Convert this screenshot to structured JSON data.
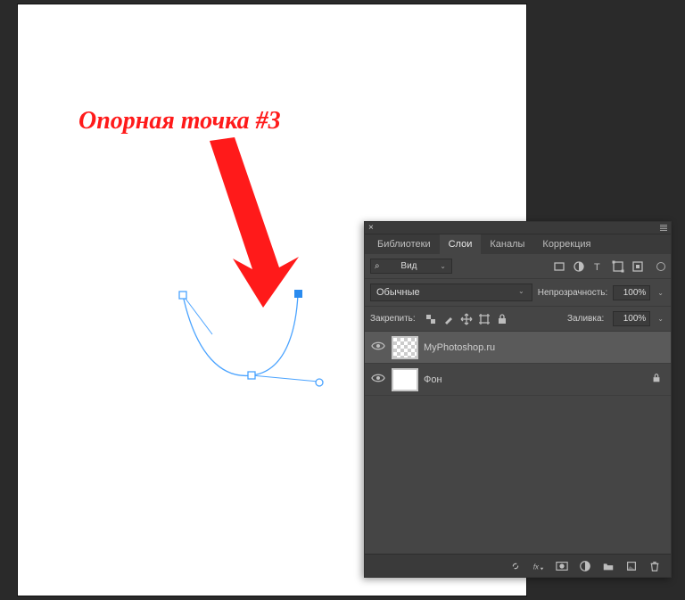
{
  "canvas": {
    "annotation_text": "Опорная точка #3"
  },
  "panel": {
    "tabs": [
      {
        "label": "Библиотеки",
        "active": false
      },
      {
        "label": "Слои",
        "active": true
      },
      {
        "label": "Каналы",
        "active": false
      },
      {
        "label": "Коррекция",
        "active": false
      }
    ],
    "filter": {
      "kind_label": "Вид",
      "search_glyph": "⌕"
    },
    "blend": {
      "mode_label": "Обычные",
      "opacity_label": "Непрозрачность:",
      "opacity_value": "100%"
    },
    "lock": {
      "lock_label": "Закрепить:",
      "fill_label": "Заливка:",
      "fill_value": "100%"
    },
    "layers": [
      {
        "name": "MyPhotoshop.ru",
        "selected": true,
        "checker": true,
        "locked": false
      },
      {
        "name": "Фон",
        "selected": false,
        "checker": false,
        "locked": true
      }
    ]
  }
}
